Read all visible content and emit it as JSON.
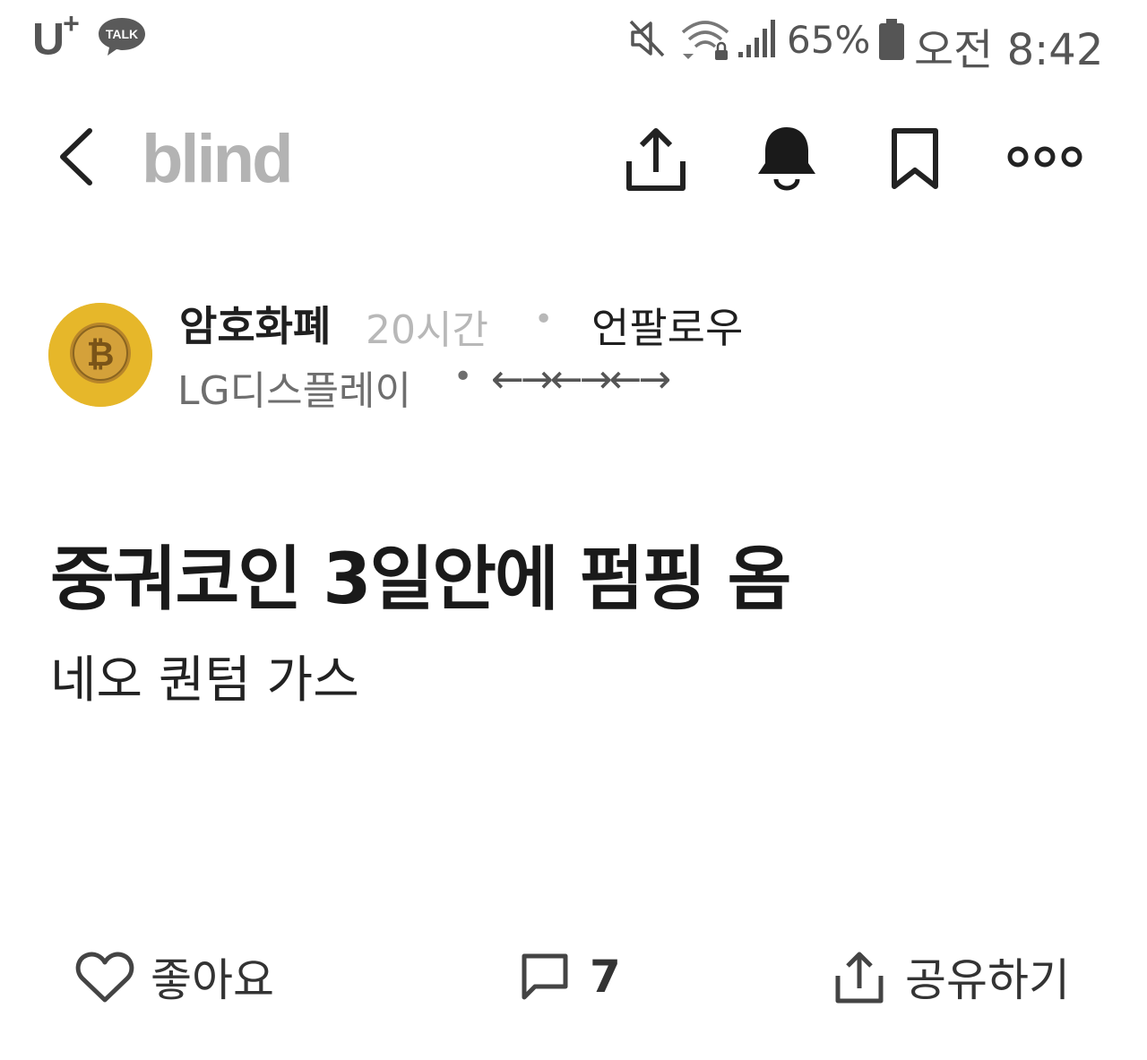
{
  "status_bar": {
    "carrier": "U",
    "carrier_plus": "+",
    "talk_badge": "TALK",
    "battery_percent": "65%",
    "time": "오전 8:42",
    "icons": [
      "kakaotalk-icon",
      "mute-icon",
      "wifi-icon",
      "signal-icon",
      "battery-icon"
    ]
  },
  "header": {
    "brand": "blind",
    "icons": [
      "back-icon",
      "share-icon",
      "bell-icon",
      "bookmark-icon",
      "more-icon"
    ]
  },
  "author": {
    "name": "암호화폐",
    "time": "20시간",
    "separator": "•",
    "follow": "언팔로우",
    "company": "LG디스플레이",
    "nickname": "←→←→←→"
  },
  "post": {
    "title": "중궈코인 3일안에 펌핑 옴",
    "body": "네오 퀀텀 가스"
  },
  "actions": {
    "like_label": "좋아요",
    "comment_count": "7",
    "share_label": "공유하기"
  },
  "colors": {
    "avatar_bg": "#e6b72a",
    "brand_gray": "#b3b3b3",
    "muted_text": "#b8b8b8"
  }
}
